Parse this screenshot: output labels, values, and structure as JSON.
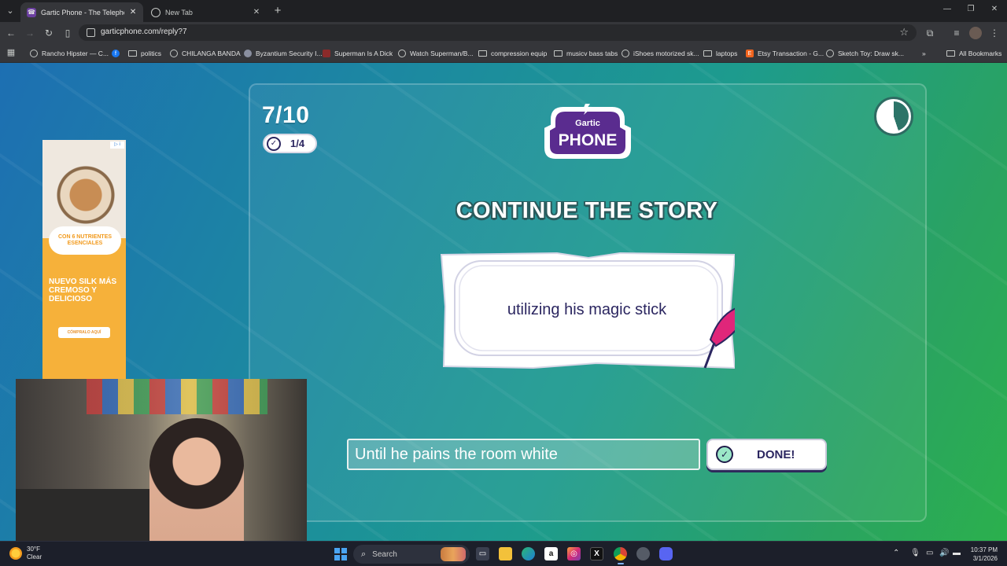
{
  "browser": {
    "tabs": [
      {
        "title": "Gartic Phone - The Telephone G",
        "active": true,
        "favicon": "gartic-phone-icon"
      },
      {
        "title": "New Tab",
        "active": false,
        "favicon": "chrome-icon"
      }
    ],
    "url": "garticphone.com/reply?7",
    "bookmarks": [
      {
        "label": "Rancho Hipster — C...",
        "icon": "globe-icon"
      },
      {
        "label": "",
        "icon": "facebook-icon"
      },
      {
        "label": "politics",
        "icon": "folder-icon"
      },
      {
        "label": "CHILANGA BANDA",
        "icon": "globe-icon"
      },
      {
        "label": "Byzantium Security I...",
        "icon": "bell-icon"
      },
      {
        "label": "Superman Is A Dick",
        "icon": "image-icon"
      },
      {
        "label": "Watch Superman/B...",
        "icon": "globe-icon"
      },
      {
        "label": "compression equip",
        "icon": "folder-icon"
      },
      {
        "label": "musicv bass tabs",
        "icon": "folder-icon"
      },
      {
        "label": "iShoes motorized sk...",
        "icon": "globe-icon"
      },
      {
        "label": "laptops",
        "icon": "folder-icon"
      },
      {
        "label": "Etsy Transaction - G...",
        "icon": "etsy-icon"
      },
      {
        "label": "Sketch Toy: Draw sk...",
        "icon": "globe-icon"
      }
    ],
    "all_bookmarks_label": "All Bookmarks"
  },
  "game": {
    "round": "7/10",
    "players_done": "1/4",
    "logo_top": "Gartic",
    "logo_bottom": "PHONE",
    "heading": "CONTINUE THE STORY",
    "prompt": "utilizing his magic stick",
    "answer_value": "Until he pains the room white",
    "done_label": "DONE!",
    "timer_progress": 0.45
  },
  "ad": {
    "choices_label": "▷ i",
    "badge": "CON 6 NUTRIENTES ESENCIALES",
    "headline": "NUEVO SILK MÁS CREMOSO Y DELICIOSO",
    "cta": "CÓMPRALO AQUÍ"
  },
  "taskbar": {
    "weather_temp": "30°F",
    "weather_desc": "Clear",
    "search_label": "Search",
    "time": "10:37 PM",
    "date": "3/1/2026"
  },
  "colors": {
    "accent_purple": "#2b2660",
    "page_gradient_start": "#1d6fb2",
    "page_gradient_end": "#2bb04d",
    "heading_shadow": "#2a5a5c"
  }
}
